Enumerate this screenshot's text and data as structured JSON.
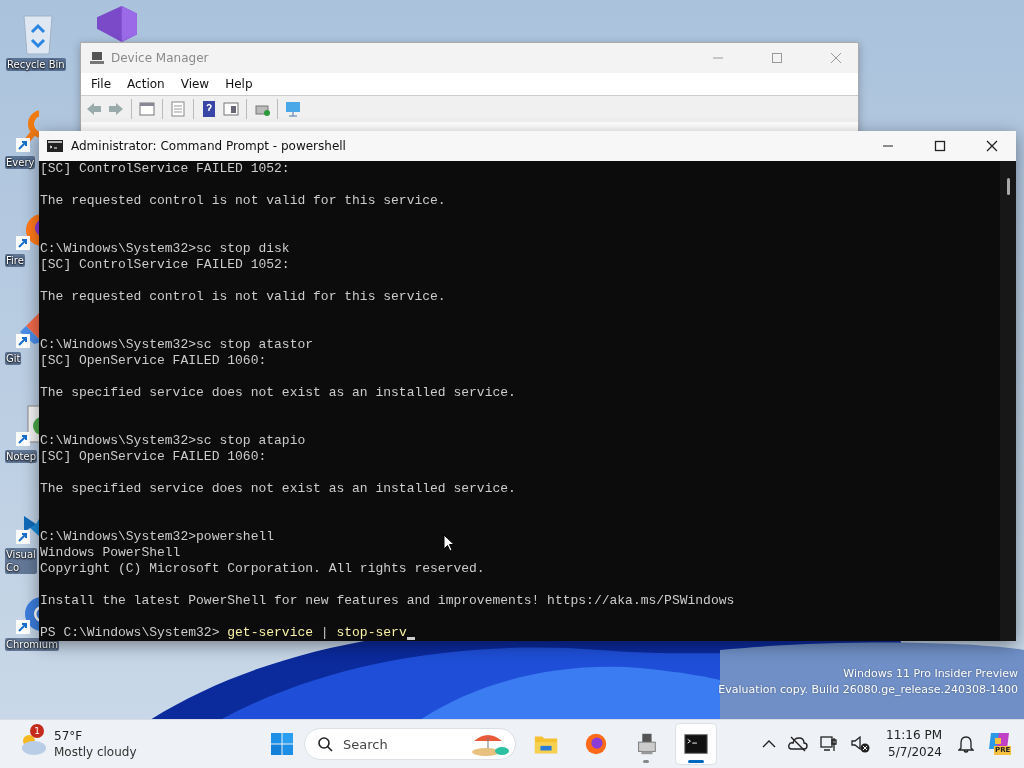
{
  "desktop_icons": [
    {
      "label": "Recycle Bin",
      "kind": "recycle",
      "shortcut": false
    },
    {
      "label": "Every",
      "kind": "magnifier",
      "shortcut": true
    },
    {
      "label": "Fire",
      "kind": "fox",
      "shortcut": true
    },
    {
      "label": "Git",
      "kind": "git",
      "shortcut": true
    },
    {
      "label": "Notep",
      "kind": "notepad",
      "shortcut": true
    },
    {
      "label": "Visual Co",
      "kind": "code",
      "shortcut": true
    },
    {
      "label": "Chromium",
      "kind": "chromium",
      "shortcut": true
    }
  ],
  "device_manager": {
    "title": "Device Manager",
    "active": false,
    "menu": [
      "File",
      "Action",
      "View",
      "Help"
    ]
  },
  "console": {
    "title": "Administrator: Command Prompt - powershell",
    "active": true,
    "sessions": [
      {
        "status": "[SC] ControlService FAILED 1052:",
        "message": "The requested control is not valid for this service."
      },
      {
        "command": "C:\\Windows\\System32>sc stop disk",
        "status": "[SC] ControlService FAILED 1052:",
        "message": "The requested control is not valid for this service."
      },
      {
        "command": "C:\\Windows\\System32>sc stop atastor",
        "status": "[SC] OpenService FAILED 1060:",
        "message": "The specified service does not exist as an installed service."
      },
      {
        "command": "C:\\Windows\\System32>sc stop atapio",
        "status": "[SC] OpenService FAILED 1060:",
        "message": "The specified service does not exist as an installed service."
      }
    ],
    "powershell": {
      "command": "C:\\Windows\\System32>powershell",
      "banner": [
        "Windows PowerShell",
        "Copyright (C) Microsoft Corporation. All rights reserved."
      ],
      "notice": "Install the latest PowerShell for new features and improvements! https://aka.ms/PSWindows",
      "prompt": "PS C:\\Windows\\System32>",
      "input": [
        {
          "text": "get-service",
          "kind": "command"
        },
        {
          "text": "|",
          "kind": "operator"
        },
        {
          "text": "stop-serv",
          "kind": "command"
        }
      ]
    }
  },
  "evaluation_notice": [
    "Windows 11 Pro Insider Preview",
    "Evaluation copy. Build 26080.ge_release.240308-1400"
  ],
  "taskbar": {
    "weather": {
      "badge": "1",
      "temperature": "57°F",
      "condition": "Mostly cloudy"
    },
    "search": {
      "placeholder": "Search"
    },
    "apps": [
      {
        "kind": "folder",
        "running": false,
        "active": false
      },
      {
        "kind": "fox",
        "running": false,
        "active": false
      },
      {
        "kind": "device-manager",
        "running": true,
        "active": false
      },
      {
        "kind": "terminal",
        "running": true,
        "active": true
      }
    ],
    "clock": {
      "time": "11:16 PM",
      "date": "5/7/2024"
    },
    "copilot_badge": "PRE"
  }
}
